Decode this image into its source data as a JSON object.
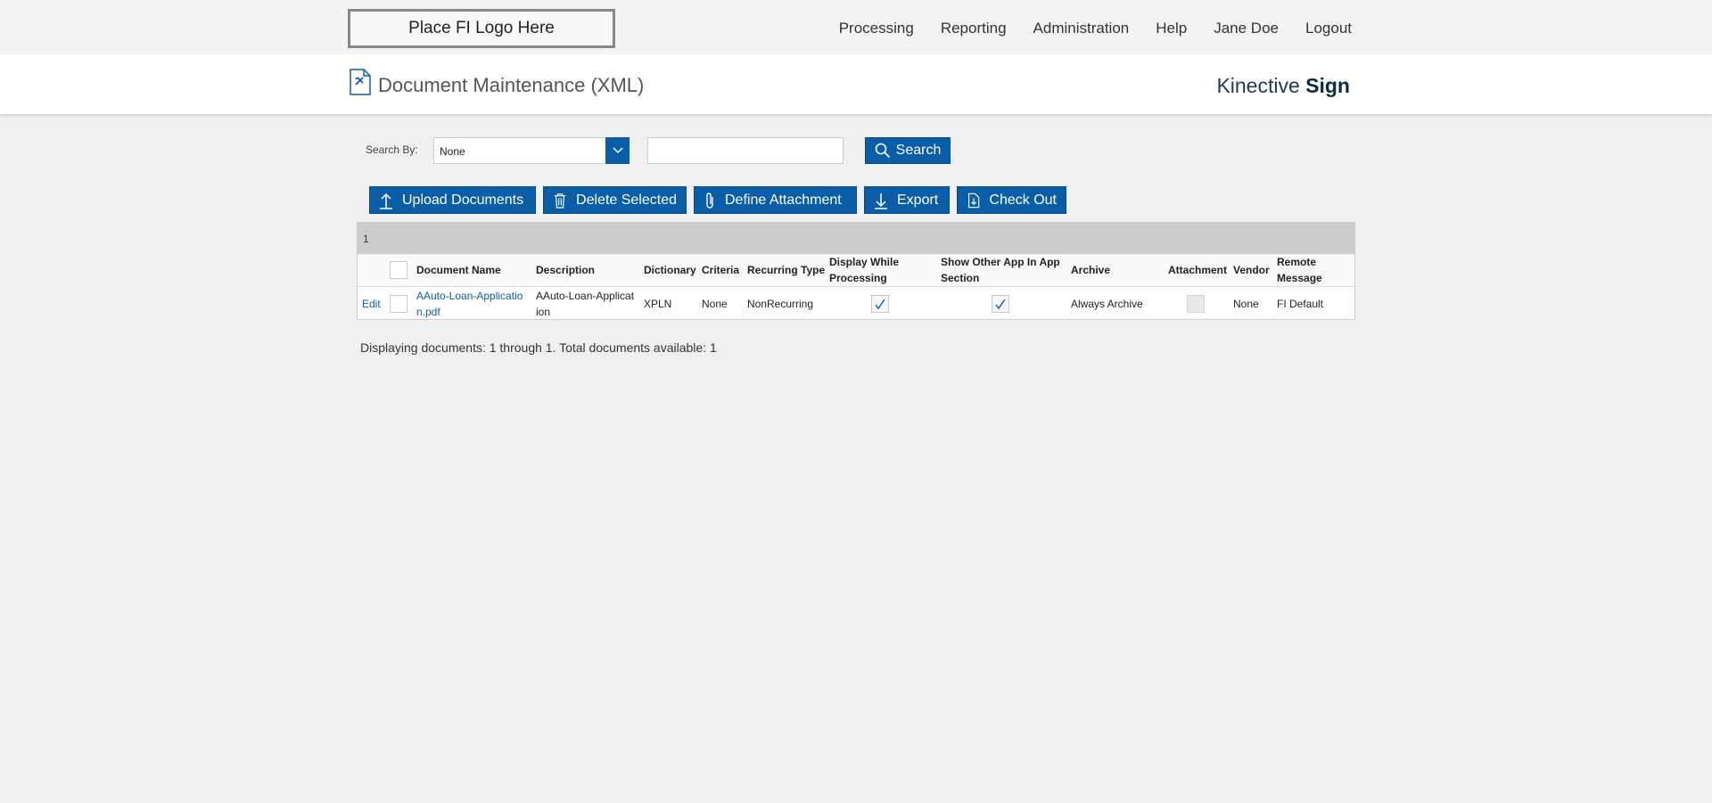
{
  "topbar": {
    "logo_text": "Place FI Logo Here",
    "nav": [
      "Processing",
      "Reporting",
      "Administration",
      "Help",
      "Jane Doe",
      "Logout"
    ]
  },
  "header": {
    "title": "Document Maintenance (XML)",
    "brand_main": "Kinective",
    "brand_bold": "Sign"
  },
  "search": {
    "label": "Search By:",
    "selected": "None",
    "input_value": "",
    "button_label": "Search"
  },
  "actions": {
    "upload": "Upload Documents",
    "delete": "Delete Selected",
    "define_attachment": "Define Attachment",
    "export": "Export",
    "check_out": "Check Out"
  },
  "table": {
    "page_number": "1",
    "headers": {
      "document_name": "Document Name",
      "description": "Description",
      "dictionary": "Dictionary",
      "criteria": "Criteria",
      "recurring_type": "Recurring Type",
      "display_while_processing": "Display While Processing",
      "show_other_app": "Show Other App In App Section",
      "archive": "Archive",
      "attachment": "Attachment",
      "vendor": "Vendor",
      "remote_message": "Remote Message"
    },
    "rows": [
      {
        "edit": "Edit",
        "document_name": "AAuto-Loan-Application.pdf",
        "description": "AAuto-Loan-Application",
        "dictionary": "XPLN",
        "criteria": "None",
        "recurring_type": "NonRecurring",
        "display_while_processing": true,
        "show_other_app": true,
        "archive": "Always Archive",
        "attachment": false,
        "vendor": "None",
        "remote_message": "FI Default"
      }
    ]
  },
  "footer": {
    "status": "Displaying documents: 1 through 1. Total documents available: 1"
  },
  "colors": {
    "accent": "#0a5ea8",
    "background": "#f0f0f0",
    "pager_bg": "#cdcdcd"
  }
}
